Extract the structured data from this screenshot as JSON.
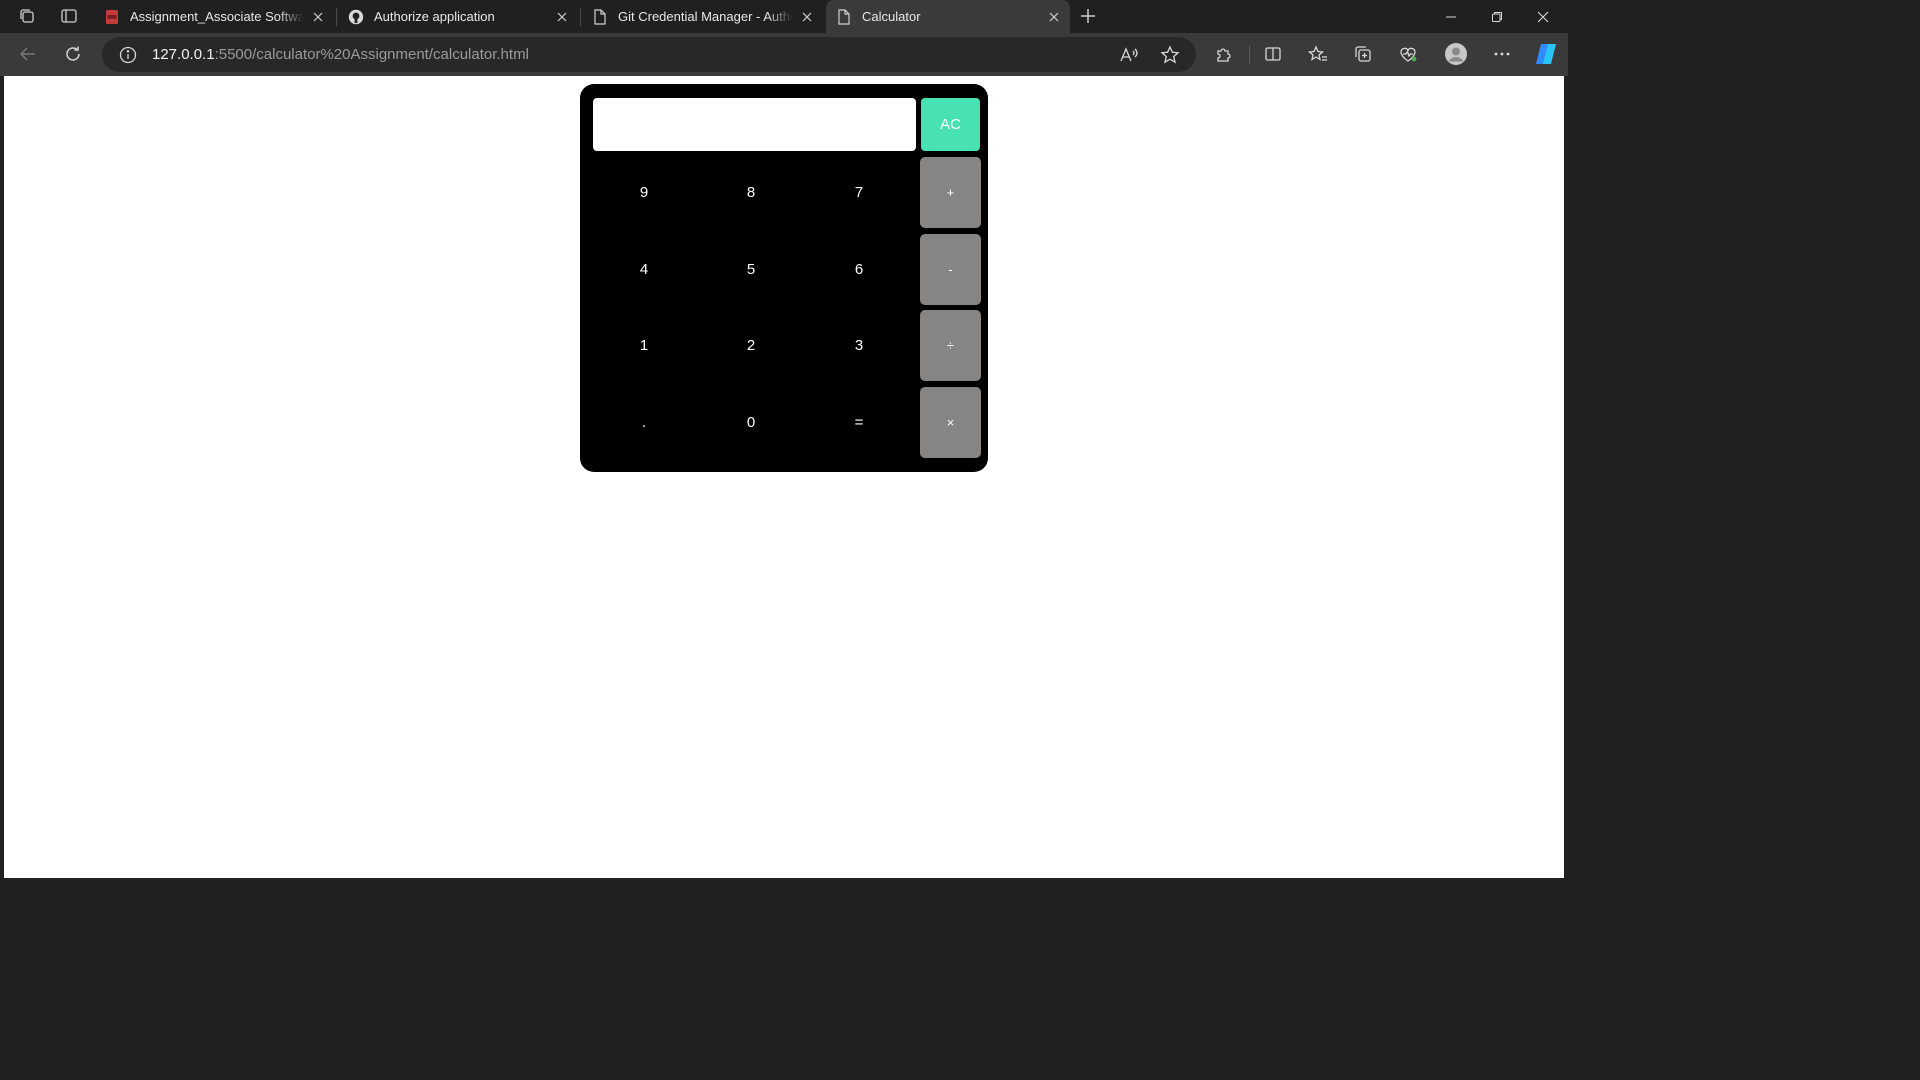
{
  "browser": {
    "tabs": [
      {
        "title": "Assignment_Associate Software Engineer",
        "favicon": "pdf-icon",
        "active": false
      },
      {
        "title": "Authorize application",
        "favicon": "github-icon",
        "active": false
      },
      {
        "title": "Git Credential Manager - Authentication",
        "favicon": "page-icon",
        "active": false
      },
      {
        "title": "Calculator",
        "favicon": "page-icon",
        "active": true
      }
    ],
    "address_bar": {
      "host": "127.0.0.1",
      "rest": ":5500/calculator%20Assignment/calculator.html"
    },
    "accent_colors": {
      "copilot": "#3aa0ff",
      "health_badge": "#4caf50"
    }
  },
  "calculator": {
    "display_value": "",
    "clear_label": "AC",
    "digits": {
      "nine": "9",
      "eight": "8",
      "seven": "7",
      "four": "4",
      "five": "5",
      "six": "6",
      "one": "1",
      "two": "2",
      "three": "3",
      "dot": ".",
      "zero": "0",
      "equals": "="
    },
    "operators": {
      "plus": "+",
      "minus": "-",
      "divide": "÷",
      "multiply": "×"
    },
    "colors": {
      "body": "#000000",
      "clear_button": "#48e2b2",
      "operator_button": "#878484",
      "display": "#ffffff"
    }
  }
}
